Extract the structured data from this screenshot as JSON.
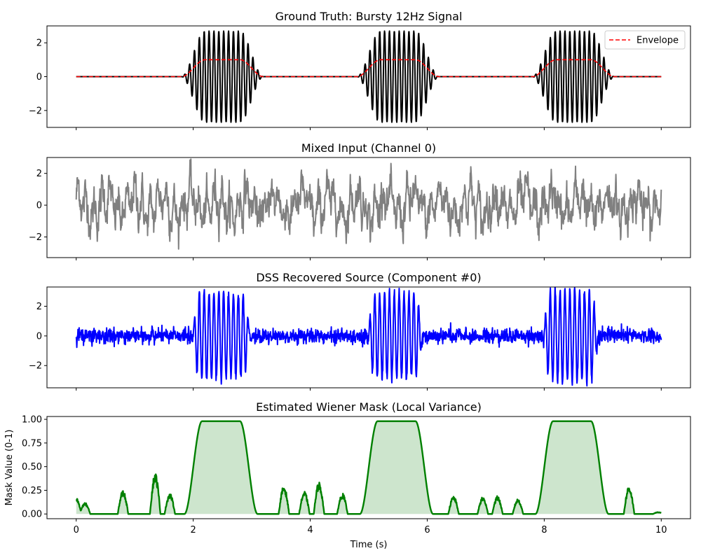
{
  "chart_data": [
    {
      "type": "line",
      "title": "Ground Truth: Bursty 12Hz Signal",
      "xlabel": "",
      "ylabel": "",
      "xlim": [
        -0.5,
        10.5
      ],
      "ylim": [
        -3.0,
        3.0
      ],
      "yticks": [
        -2,
        0,
        2
      ],
      "ytick_labels": [
        "−2",
        "0",
        "2"
      ],
      "burst_frequency_hz": 12,
      "bursts": [
        {
          "start": 1.8,
          "end": 3.2,
          "peak_amplitude": 2.7
        },
        {
          "start": 4.8,
          "end": 6.2,
          "peak_amplitude": 2.7
        },
        {
          "start": 7.8,
          "end": 9.2,
          "peak_amplitude": 2.7
        }
      ],
      "envelope_max": 1.0,
      "legend_position": "top-right",
      "series": [
        {
          "name": "",
          "color": "#000000",
          "style": "solid"
        },
        {
          "name": "Envelope",
          "color": "#ff0000",
          "style": "dashed"
        }
      ]
    },
    {
      "type": "line",
      "title": "Mixed Input (Channel 0)",
      "xlabel": "",
      "ylabel": "",
      "xlim": [
        -0.5,
        10.5
      ],
      "ylim": [
        -3.3,
        3.0
      ],
      "yticks": [
        -2,
        0,
        2
      ],
      "ytick_labels": [
        "−2",
        "0",
        "2"
      ],
      "value_range": [
        -3.2,
        2.9
      ],
      "series": [
        {
          "name": "",
          "color": "#808080",
          "style": "solid"
        }
      ]
    },
    {
      "type": "line",
      "title": "DSS Recovered Source (Component #0)",
      "xlabel": "",
      "ylabel": "",
      "xlim": [
        -0.5,
        10.5
      ],
      "ylim": [
        -3.5,
        3.3
      ],
      "yticks": [
        -2,
        0,
        2
      ],
      "ytick_labels": [
        "−2",
        "0",
        "2"
      ],
      "bursts": [
        {
          "start": 1.95,
          "end": 3.0,
          "peak_amplitude": 2.9
        },
        {
          "start": 4.95,
          "end": 5.95,
          "peak_amplitude": 2.9
        },
        {
          "start": 7.95,
          "end": 8.95,
          "peak_amplitude": 3.1
        }
      ],
      "baseline_noise_amplitude": 0.35,
      "series": [
        {
          "name": "",
          "color": "#0000ff",
          "style": "solid"
        }
      ]
    },
    {
      "type": "area",
      "title": "Estimated Wiener Mask (Local Variance)",
      "xlabel": "Time (s)",
      "ylabel": "Mask Value (0-1)",
      "xlim": [
        -0.5,
        10.5
      ],
      "ylim": [
        -0.05,
        1.03
      ],
      "xticks": [
        0,
        2,
        4,
        6,
        8,
        10
      ],
      "xtick_labels": [
        "0",
        "2",
        "4",
        "6",
        "8",
        "10"
      ],
      "yticks": [
        0.0,
        0.25,
        0.5,
        0.75,
        1.0
      ],
      "ytick_labels": [
        "0.00",
        "0.25",
        "0.50",
        "0.75",
        "1.00"
      ],
      "plateaus": [
        {
          "start": 1.85,
          "end": 3.1,
          "value": 0.98
        },
        {
          "start": 4.85,
          "end": 6.1,
          "value": 0.98
        },
        {
          "start": 7.85,
          "end": 9.1,
          "value": 0.98
        }
      ],
      "minor_bumps": [
        {
          "center": 0.0,
          "value": 0.17
        },
        {
          "center": 0.15,
          "value": 0.12
        },
        {
          "center": 0.8,
          "value": 0.25
        },
        {
          "center": 1.35,
          "value": 0.44
        },
        {
          "center": 1.6,
          "value": 0.22
        },
        {
          "center": 3.55,
          "value": 0.3
        },
        {
          "center": 3.9,
          "value": 0.24
        },
        {
          "center": 4.15,
          "value": 0.34
        },
        {
          "center": 4.55,
          "value": 0.22
        },
        {
          "center": 6.45,
          "value": 0.19
        },
        {
          "center": 6.95,
          "value": 0.18
        },
        {
          "center": 7.2,
          "value": 0.19
        },
        {
          "center": 7.55,
          "value": 0.16
        },
        {
          "center": 9.45,
          "value": 0.3
        },
        {
          "center": 9.95,
          "value": 0.02
        }
      ],
      "series": [
        {
          "name": "",
          "color": "#008000",
          "fill_color": "#cde5cd",
          "style": "solid"
        }
      ]
    }
  ]
}
